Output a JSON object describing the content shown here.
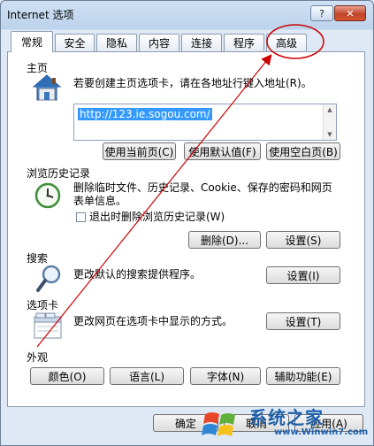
{
  "window": {
    "title": "Internet 选项",
    "help_label": "?",
    "close_label": "✕"
  },
  "tabs": [
    {
      "label": "常规",
      "active": true
    },
    {
      "label": "安全"
    },
    {
      "label": "隐私"
    },
    {
      "label": "内容"
    },
    {
      "label": "连接"
    },
    {
      "label": "程序"
    },
    {
      "label": "高级"
    }
  ],
  "home": {
    "title": "主页",
    "description": "若要创建主页选项卡，请在各地址行键入地址(R)。",
    "url": "http://123.ie.sogou.com/",
    "use_current": "使用当前页(C)",
    "use_default": "使用默认值(F)",
    "use_blank": "使用空白页(B)"
  },
  "history": {
    "title": "浏览历史记录",
    "description": "删除临时文件、历史记录、Cookie、保存的密码和网页表单信息。",
    "checkbox_label": "退出时删除浏览历史记录(W)",
    "delete_button": "删除(D)...",
    "settings_button": "设置(S)"
  },
  "search": {
    "title": "搜索",
    "description": "更改默认的搜索提供程序。",
    "settings_button": "设置(I)"
  },
  "tabs_section": {
    "title": "选项卡",
    "description": "更改网页在选项卡中显示的方式。",
    "settings_button": "设置(T)"
  },
  "appearance": {
    "title": "外观",
    "colors_button": "颜色(O)",
    "languages_button": "语言(L)",
    "fonts_button": "字体(N)",
    "accessibility_button": "辅助功能(E)"
  },
  "footer": {
    "ok_button": "确定",
    "cancel_button": "取消",
    "apply_button": "应用(A)"
  },
  "watermark": {
    "text": "系统之家",
    "url": "www.Winwin7.com"
  },
  "colors": {
    "annotation_red": "#cc0000",
    "selection_blue": "#3399ff",
    "watermark_blue": "#1d5faa"
  }
}
